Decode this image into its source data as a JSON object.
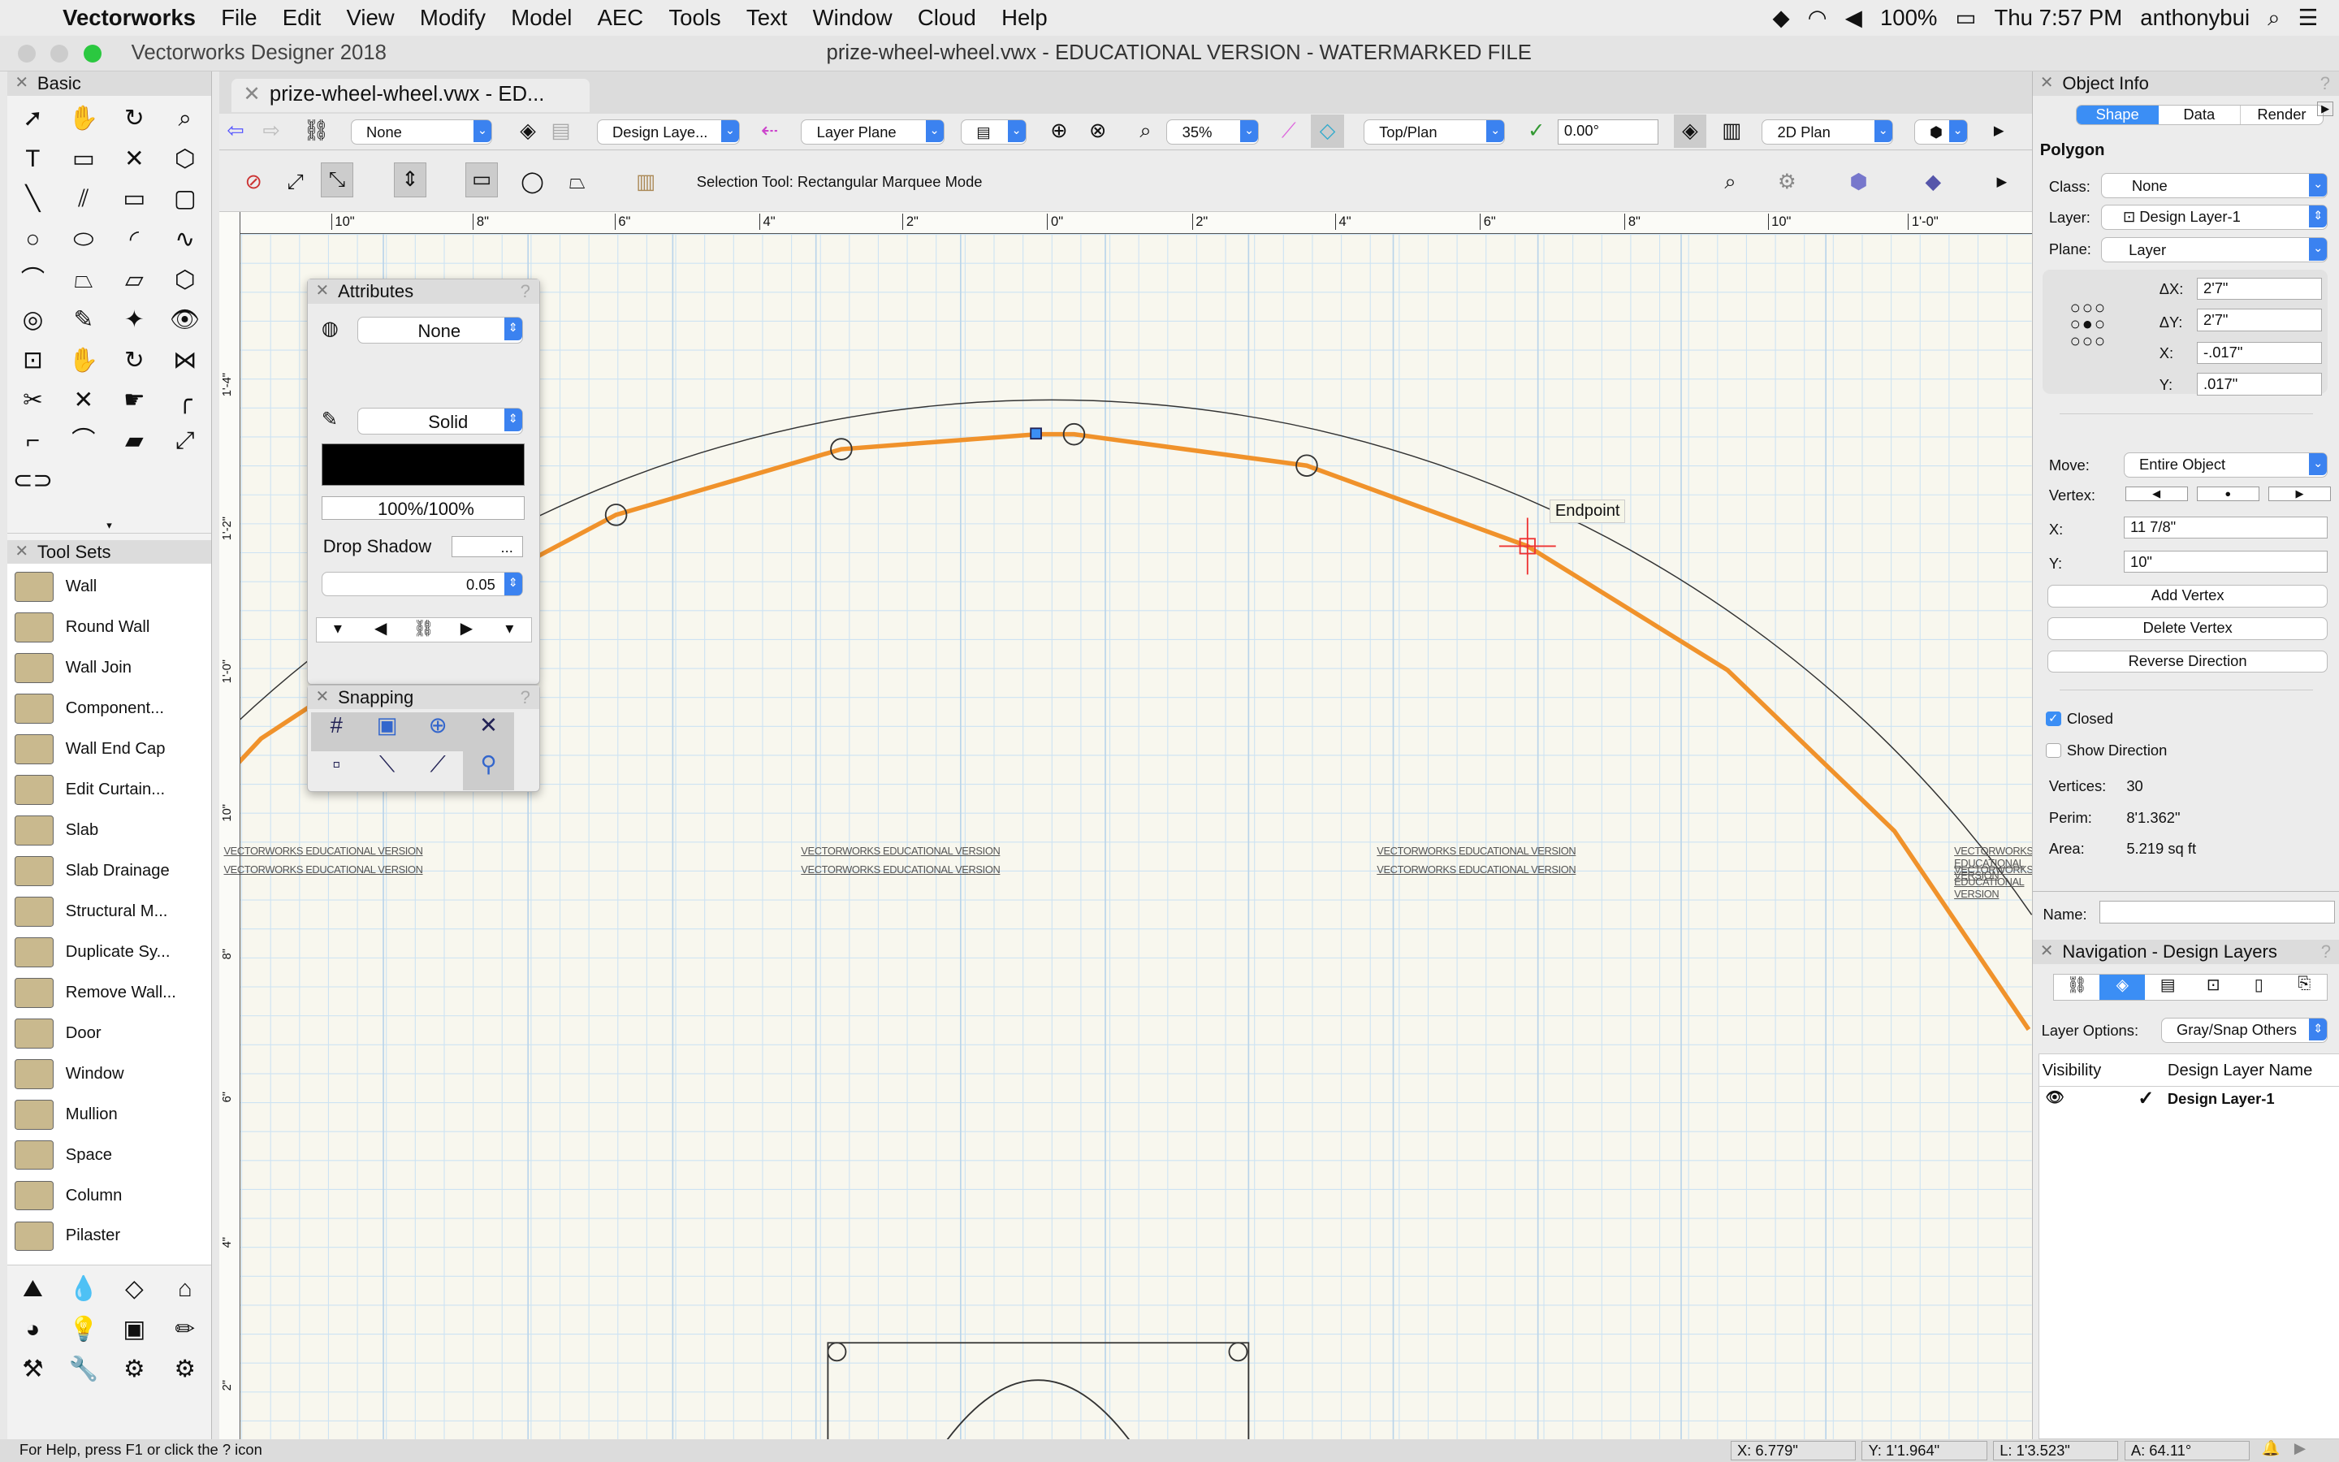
{
  "menubar": {
    "app": "Vectorworks",
    "items": [
      "File",
      "Edit",
      "View",
      "Modify",
      "Model",
      "AEC",
      "Tools",
      "Text",
      "Window",
      "Cloud",
      "Help"
    ],
    "battery": "100%",
    "clock": "Thu 7:57 PM",
    "user": "anthonybui"
  },
  "window": {
    "app_title": "Vectorworks Designer 2018",
    "doc_title": "prize-wheel-wheel.vwx - EDUCATIONAL VERSION - WATERMARKED FILE",
    "tab": "prize-wheel-wheel.vwx - ED..."
  },
  "view_bar": {
    "class": "None",
    "layer": "Design Laye...",
    "plane": "Layer Plane",
    "zoom": "35%",
    "view": "Top/Plan",
    "rotation": "0.00°",
    "render": "2D Plan"
  },
  "mode_bar": {
    "message": "Selection Tool: Rectangular Marquee Mode"
  },
  "basic_palette": {
    "title": "Basic"
  },
  "tool_sets": {
    "title": "Tool Sets",
    "items": [
      "Wall",
      "Round Wall",
      "Wall Join",
      "Component...",
      "Wall End Cap",
      "Edit Curtain...",
      "Slab",
      "Slab Drainage",
      "Structural M...",
      "Duplicate Sy...",
      "Remove Wall...",
      "Door",
      "Window",
      "Mullion",
      "Space",
      "Column",
      "Pilaster"
    ]
  },
  "attributes": {
    "title": "Attributes",
    "fill": "None",
    "pen": "Solid",
    "opacity": "100%/100%",
    "drop_shadow": "Drop Shadow",
    "line_weight": "0.05",
    "more": "..."
  },
  "snapping": {
    "title": "Snapping"
  },
  "rulers": {
    "top": [
      "10\"",
      "8\"",
      "6\"",
      "4\"",
      "2\"",
      "0\"",
      "2\"",
      "4\"",
      "6\"",
      "8\"",
      "10\"",
      "1'-0\""
    ],
    "left": [
      "1'-4\"",
      "1'-2\"",
      "1'-0\"",
      "10\"",
      "8\"",
      "6\"",
      "4\"",
      "2\""
    ]
  },
  "drawing": {
    "snap_tip": "Endpoint",
    "watermark": "VECTORWORKS EDUCATIONAL VERSION",
    "line_color": "#f0922b"
  },
  "object_info": {
    "title": "Object Info",
    "tabs": [
      "Shape",
      "Data",
      "Render"
    ],
    "object_type": "Polygon",
    "class_label": "Class:",
    "class": "None",
    "layer_label": "Layer:",
    "layer": "Design Layer-1",
    "plane_label": "Plane:",
    "plane": "Layer",
    "dx_label": "ΔX:",
    "dx": "2'7\"",
    "dy_label": "ΔY:",
    "dy": "2'7\"",
    "x_label": "X:",
    "x": "-.017\"",
    "y_label": "Y:",
    "y": ".017\"",
    "move_label": "Move:",
    "move": "Entire Object",
    "vertex_label": "Vertex:",
    "vx_label": "X:",
    "vx": "11 7/8\"",
    "vy_label": "Y:",
    "vy": "10\"",
    "add_vertex": "Add Vertex",
    "delete_vertex": "Delete Vertex",
    "reverse_direction": "Reverse Direction",
    "closed_label": "Closed",
    "closed": true,
    "show_direction_label": "Show Direction",
    "show_direction": false,
    "vertices_label": "Vertices:",
    "vertices": "30",
    "perim_label": "Perim:",
    "perim": "8'1.362\"",
    "area_label": "Area:",
    "area": "5.219 sq ft",
    "name_label": "Name:",
    "name": ""
  },
  "navigation": {
    "title": "Navigation - Design Layers",
    "layer_options_label": "Layer Options:",
    "layer_options": "Gray/Snap Others",
    "columns": [
      "Visibility",
      "Design Layer Name"
    ],
    "rows": [
      {
        "name": "Design Layer-1",
        "active": true
      }
    ]
  },
  "status": {
    "help": "For Help, press F1 or click the ? icon",
    "x": "X:  6.779\"",
    "y": "Y:  1'1.964\"",
    "l": "L:  1'3.523\"",
    "a": "A:  64.11°"
  }
}
